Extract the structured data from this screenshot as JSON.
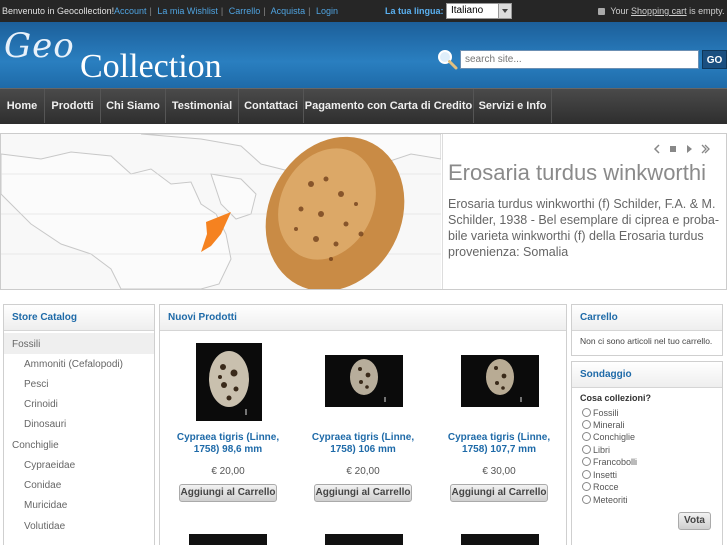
{
  "topbar": {
    "welcome": "Benvenuto in Geocollection!",
    "links": [
      "Account",
      "La mia Wishlist",
      "Carrello",
      "Acquista",
      "Login"
    ],
    "language_label": "La tua lingua:",
    "language_value": "Italiano",
    "cart_prefix": "Your",
    "cart_link": "Shopping cart",
    "cart_suffix": "is empty."
  },
  "header": {
    "logo_geo": "Geo",
    "logo_collection": "Collection",
    "search_placeholder": "search site...",
    "go_label": "GO"
  },
  "nav": [
    "Home",
    "Prodotti",
    "Chi Siamo",
    "Testimonial",
    "Contattaci",
    "Pagamento con Carta di Credito",
    "Servizi e Info"
  ],
  "banner": {
    "title": "Erosaria turdus winkworthi",
    "description": "Erosaria turdus winkworthi (f) Schilder, F.A. & M. Schilder, 1938 - Bel esemplare di ciprea e proba-bile varieta winkworthi (f) della Erosaria turdus provenienza: Somalia"
  },
  "catalog": {
    "title": "Store Catalog",
    "items": [
      {
        "label": "Fossili",
        "level": 0
      },
      {
        "label": "Ammoniti (Cefalopodi)",
        "level": 1
      },
      {
        "label": "Pesci",
        "level": 1
      },
      {
        "label": "Crinoidi",
        "level": 1
      },
      {
        "label": "Dinosauri",
        "level": 1
      },
      {
        "label": "Conchiglie",
        "level": 0
      },
      {
        "label": "Cypraeidae",
        "level": 1
      },
      {
        "label": "Conidae",
        "level": 1
      },
      {
        "label": "Muricidae",
        "level": 1
      },
      {
        "label": "Volutidae",
        "level": 1
      }
    ]
  },
  "new_products": {
    "title": "Nuovi Prodotti",
    "add_label": "Aggiungi al Carrello",
    "items": [
      {
        "name": "Cypraea tigris (Linne, 1758) 98,6 mm",
        "price": "€ 20,00"
      },
      {
        "name": "Cypraea tigris (Linne, 1758) 106 mm",
        "price": "€ 20,00"
      },
      {
        "name": "Cypraea tigris (Linne, 1758) 107,7 mm",
        "price": "€ 30,00"
      }
    ]
  },
  "cart": {
    "title": "Carrello",
    "text": "Non ci sono articoli nel tuo carrello."
  },
  "poll": {
    "title": "Sondaggio",
    "question": "Cosa collezioni?",
    "options": [
      "Fossili",
      "Minerali",
      "Conchiglie",
      "Libri",
      "Francobolli",
      "Insetti",
      "Rocce",
      "Meteoriti"
    ],
    "vote_label": "Vota"
  },
  "colors": {
    "header_blue": "#2a7fc0",
    "link_blue": "#1e6aa8",
    "topbar_bg": "#262626",
    "nav_bg": "#3a3a3a"
  }
}
